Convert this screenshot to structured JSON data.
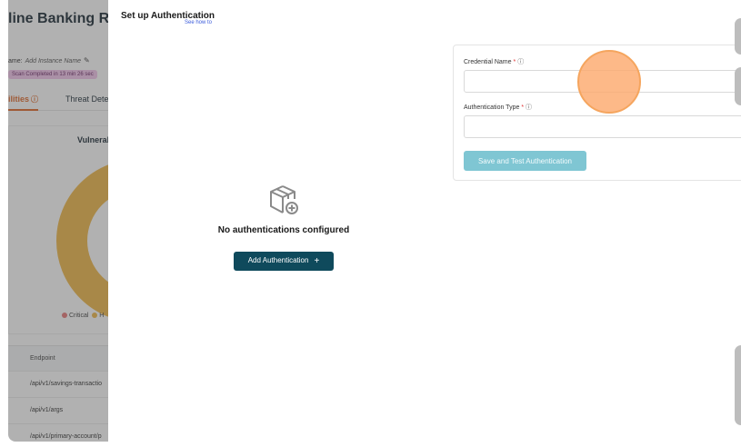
{
  "background": {
    "app_title": "line Banking RE",
    "name_label": "ame:",
    "name_value": "Add Instance Name",
    "scan_badge": "Scan Completed in 13 min 26 sec",
    "tabs": [
      {
        "label": "ilities",
        "active": true
      },
      {
        "label": "Threat Dete",
        "active": false
      }
    ],
    "card_title": "Vulnerab",
    "legend": [
      {
        "label": "Critical",
        "color": "#e97b7b"
      },
      {
        "label": "H",
        "color": "#f0b84a"
      }
    ],
    "table_header": "Endpoint",
    "table_rows": [
      "/api/v1/savings-transactio",
      "/api/v1/args",
      "/api/v1/primary-account/p"
    ]
  },
  "drawer": {
    "title": "Set up Authentication",
    "see_how": "See how to",
    "empty_state_text": "No authentications configured",
    "add_button_label": "Add Authentication",
    "add_button_icon": "plus-icon",
    "form": {
      "credential_name_label": "Credential Name",
      "credential_name_value": "",
      "authentication_type_label": "Authentication Type",
      "authentication_type_value": "",
      "required_marker": "*",
      "info_icon": "info-icon",
      "save_button_label": "Save and Test Authentication"
    }
  },
  "colors": {
    "primary_button": "#0f4a5c",
    "disabled_button": "#7fc6d3",
    "active_tab": "#e06a2c",
    "donut": "#f0b84a",
    "cursor_highlight": "#fcaa6e"
  }
}
